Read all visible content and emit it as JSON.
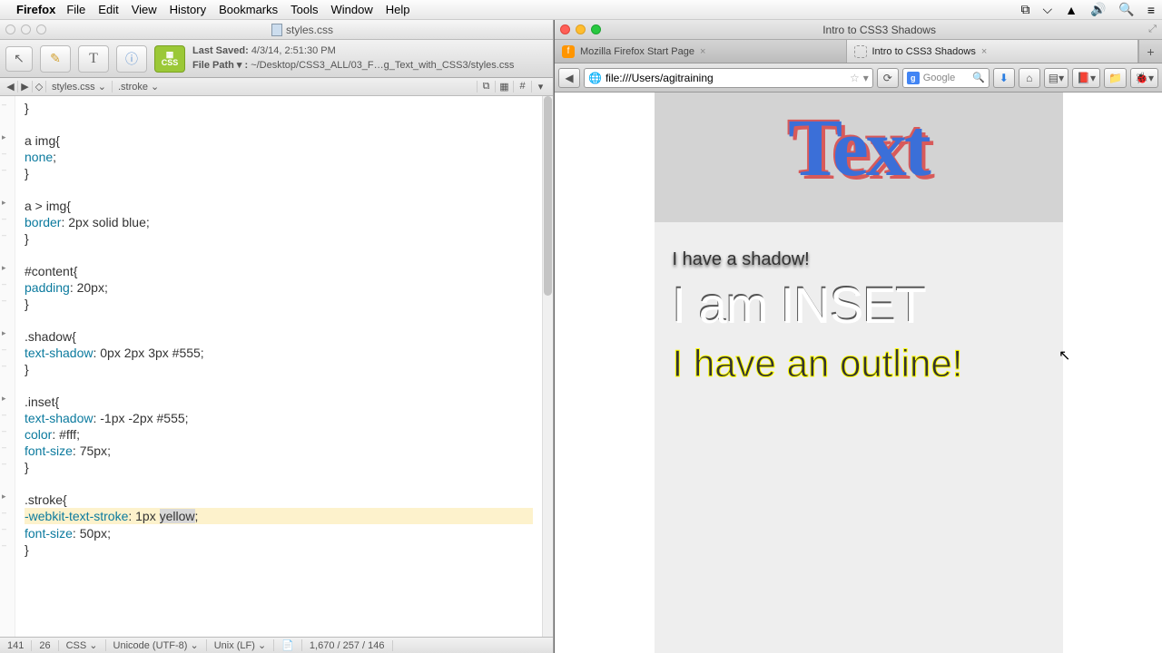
{
  "menubar": {
    "app": "Firefox",
    "items": [
      "File",
      "Edit",
      "View",
      "History",
      "Bookmarks",
      "Tools",
      "Window",
      "Help"
    ]
  },
  "editor": {
    "title": "styles.css",
    "last_saved_label": "Last Saved:",
    "last_saved": "4/3/14, 2:51:30 PM",
    "filepath_label": "File Path ▾ :",
    "filepath": "~/Desktop/CSS3_ALL/03_F…g_Text_with_CSS3/styles.css",
    "crumb_file": "styles.css",
    "crumb_symbol": ".stroke",
    "status": {
      "line": "141",
      "col": "26",
      "lang": "CSS",
      "encoding": "Unicode (UTF-8)",
      "lineend": "Unix (LF)",
      "bytes": "1,670 / 257 / 146"
    },
    "code": [
      {
        "t": "punc",
        "s": "}"
      },
      {
        "blank": true
      },
      {
        "fold": true,
        "spans": [
          {
            "c": "sel",
            "s": "a img{"
          }
        ]
      },
      {
        "spans": [
          {
            "c": "prop",
            "s": "none"
          },
          {
            "c": "punc",
            "s": ";"
          }
        ]
      },
      {
        "t": "punc",
        "s": "}"
      },
      {
        "blank": true
      },
      {
        "fold": true,
        "spans": [
          {
            "c": "sel",
            "s": "a > img{"
          }
        ]
      },
      {
        "spans": [
          {
            "c": "prop",
            "s": "border"
          },
          {
            "c": "punc",
            "s": ": "
          },
          {
            "c": "val",
            "s": "2px solid blue"
          },
          {
            "c": "punc",
            "s": ";"
          }
        ]
      },
      {
        "t": "punc",
        "s": "}"
      },
      {
        "blank": true
      },
      {
        "fold": true,
        "spans": [
          {
            "c": "sel",
            "s": "#content{"
          }
        ]
      },
      {
        "spans": [
          {
            "c": "prop",
            "s": "padding"
          },
          {
            "c": "punc",
            "s": ": "
          },
          {
            "c": "val",
            "s": "20px"
          },
          {
            "c": "punc",
            "s": ";"
          }
        ]
      },
      {
        "t": "punc",
        "s": "}"
      },
      {
        "blank": true
      },
      {
        "fold": true,
        "spans": [
          {
            "c": "sel",
            "s": ".shadow{"
          }
        ]
      },
      {
        "spans": [
          {
            "c": "prop",
            "s": "text-shadow"
          },
          {
            "c": "punc",
            "s": ": "
          },
          {
            "c": "val",
            "s": "0px 2px 3px #555"
          },
          {
            "c": "punc",
            "s": ";"
          }
        ]
      },
      {
        "t": "punc",
        "s": "}"
      },
      {
        "blank": true
      },
      {
        "fold": true,
        "spans": [
          {
            "c": "sel",
            "s": ".inset{"
          }
        ]
      },
      {
        "spans": [
          {
            "c": "prop",
            "s": "text-shadow"
          },
          {
            "c": "punc",
            "s": ": "
          },
          {
            "c": "val",
            "s": "-1px -2px #555"
          },
          {
            "c": "punc",
            "s": ";"
          }
        ]
      },
      {
        "spans": [
          {
            "c": "prop",
            "s": "color"
          },
          {
            "c": "punc",
            "s": ": "
          },
          {
            "c": "val",
            "s": "#fff"
          },
          {
            "c": "punc",
            "s": ";"
          }
        ]
      },
      {
        "spans": [
          {
            "c": "prop",
            "s": "font-size"
          },
          {
            "c": "punc",
            "s": ": "
          },
          {
            "c": "val",
            "s": "75px"
          },
          {
            "c": "punc",
            "s": ";"
          }
        ]
      },
      {
        "t": "punc",
        "s": "}"
      },
      {
        "blank": true
      },
      {
        "fold": true,
        "spans": [
          {
            "c": "sel",
            "s": ".stroke{"
          }
        ]
      },
      {
        "hl": true,
        "spans": [
          {
            "c": "prop",
            "s": "-webkit-text-stroke"
          },
          {
            "c": "punc",
            "s": ": "
          },
          {
            "c": "val",
            "s": "1px "
          },
          {
            "c": "val",
            "sel": true,
            "s": "yellow"
          },
          {
            "c": "punc",
            "s": ";"
          }
        ]
      },
      {
        "spans": [
          {
            "c": "prop",
            "s": "font-size"
          },
          {
            "c": "punc",
            "s": ": "
          },
          {
            "c": "val",
            "s": "50px"
          },
          {
            "c": "punc",
            "s": ";"
          }
        ]
      },
      {
        "t": "punc",
        "s": "}"
      }
    ]
  },
  "browser": {
    "window_title": "Intro to CSS3 Shadows",
    "tabs": [
      {
        "label": "Mozilla Firefox Start Page",
        "active": false
      },
      {
        "label": "Intro to CSS3 Shadows",
        "active": true
      }
    ],
    "url": "file:///Users/agitraining",
    "search_placeholder": "Google",
    "page": {
      "hero": "Text",
      "line1": "I have a shadow!",
      "line2": "I am INSET",
      "line3": "I have an outline!"
    }
  }
}
